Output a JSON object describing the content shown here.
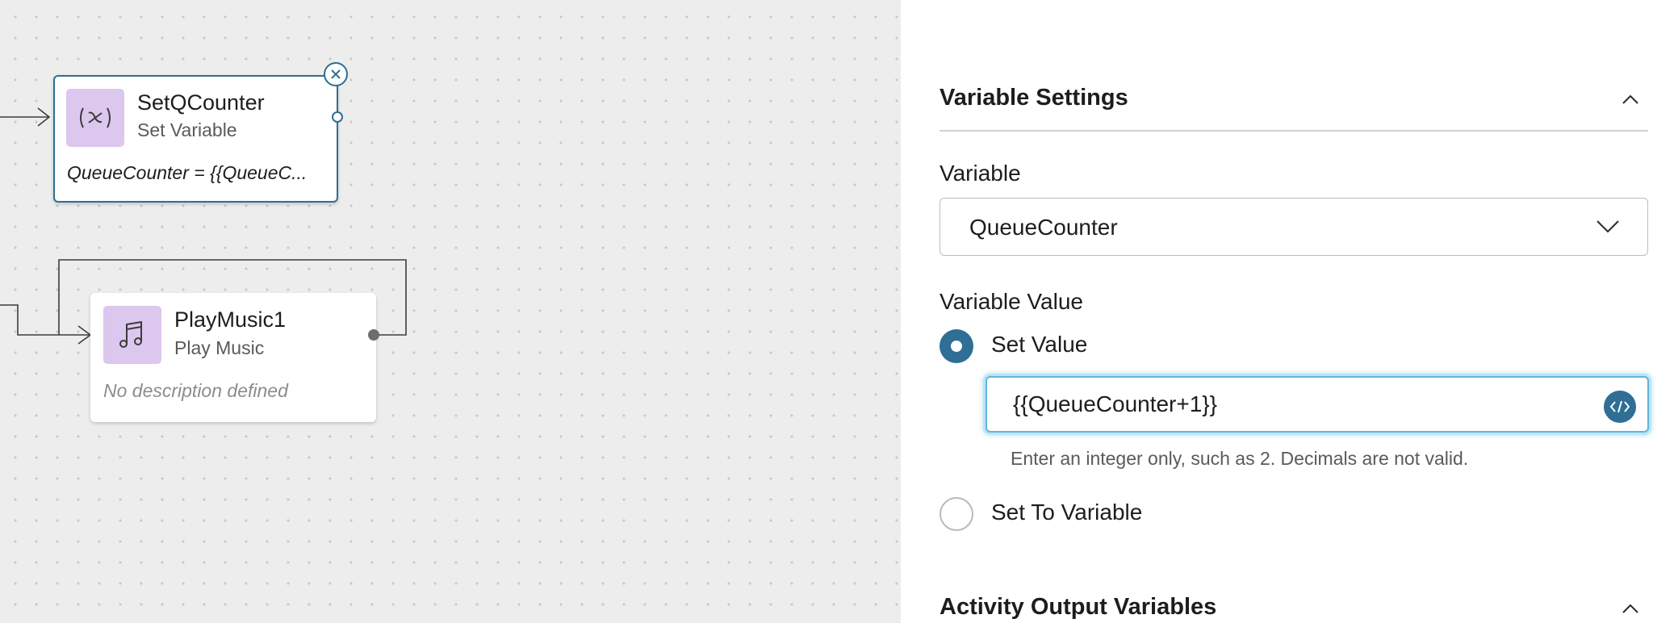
{
  "canvas": {
    "nodes": [
      {
        "title": "SetQCounter",
        "subtitle": "Set Variable",
        "description": "QueueCounter = {{QueueC...",
        "icon": "variable-icon",
        "selected": true
      },
      {
        "title": "PlayMusic1",
        "subtitle": "Play Music",
        "description": "No description defined",
        "icon": "music-note-icon",
        "selected": false
      }
    ]
  },
  "panel": {
    "variable_settings": {
      "title": "Variable Settings",
      "variable_label": "Variable",
      "variable_value": "QueueCounter",
      "value_label": "Variable Value",
      "options": [
        {
          "label": "Set Value",
          "selected": true
        },
        {
          "label": "Set To Variable",
          "selected": false
        }
      ],
      "value_input": "{{QueueCounter+1}}",
      "helper_text": "Enter an integer only, such as 2. Decimals are not valid."
    },
    "activity_output": {
      "title": "Activity Output Variables"
    }
  },
  "colors": {
    "accent": "#2f6e95",
    "icon_bg": "#dcc7ef",
    "focus": "#5fb6dc",
    "canvas_bg": "#ededed"
  }
}
